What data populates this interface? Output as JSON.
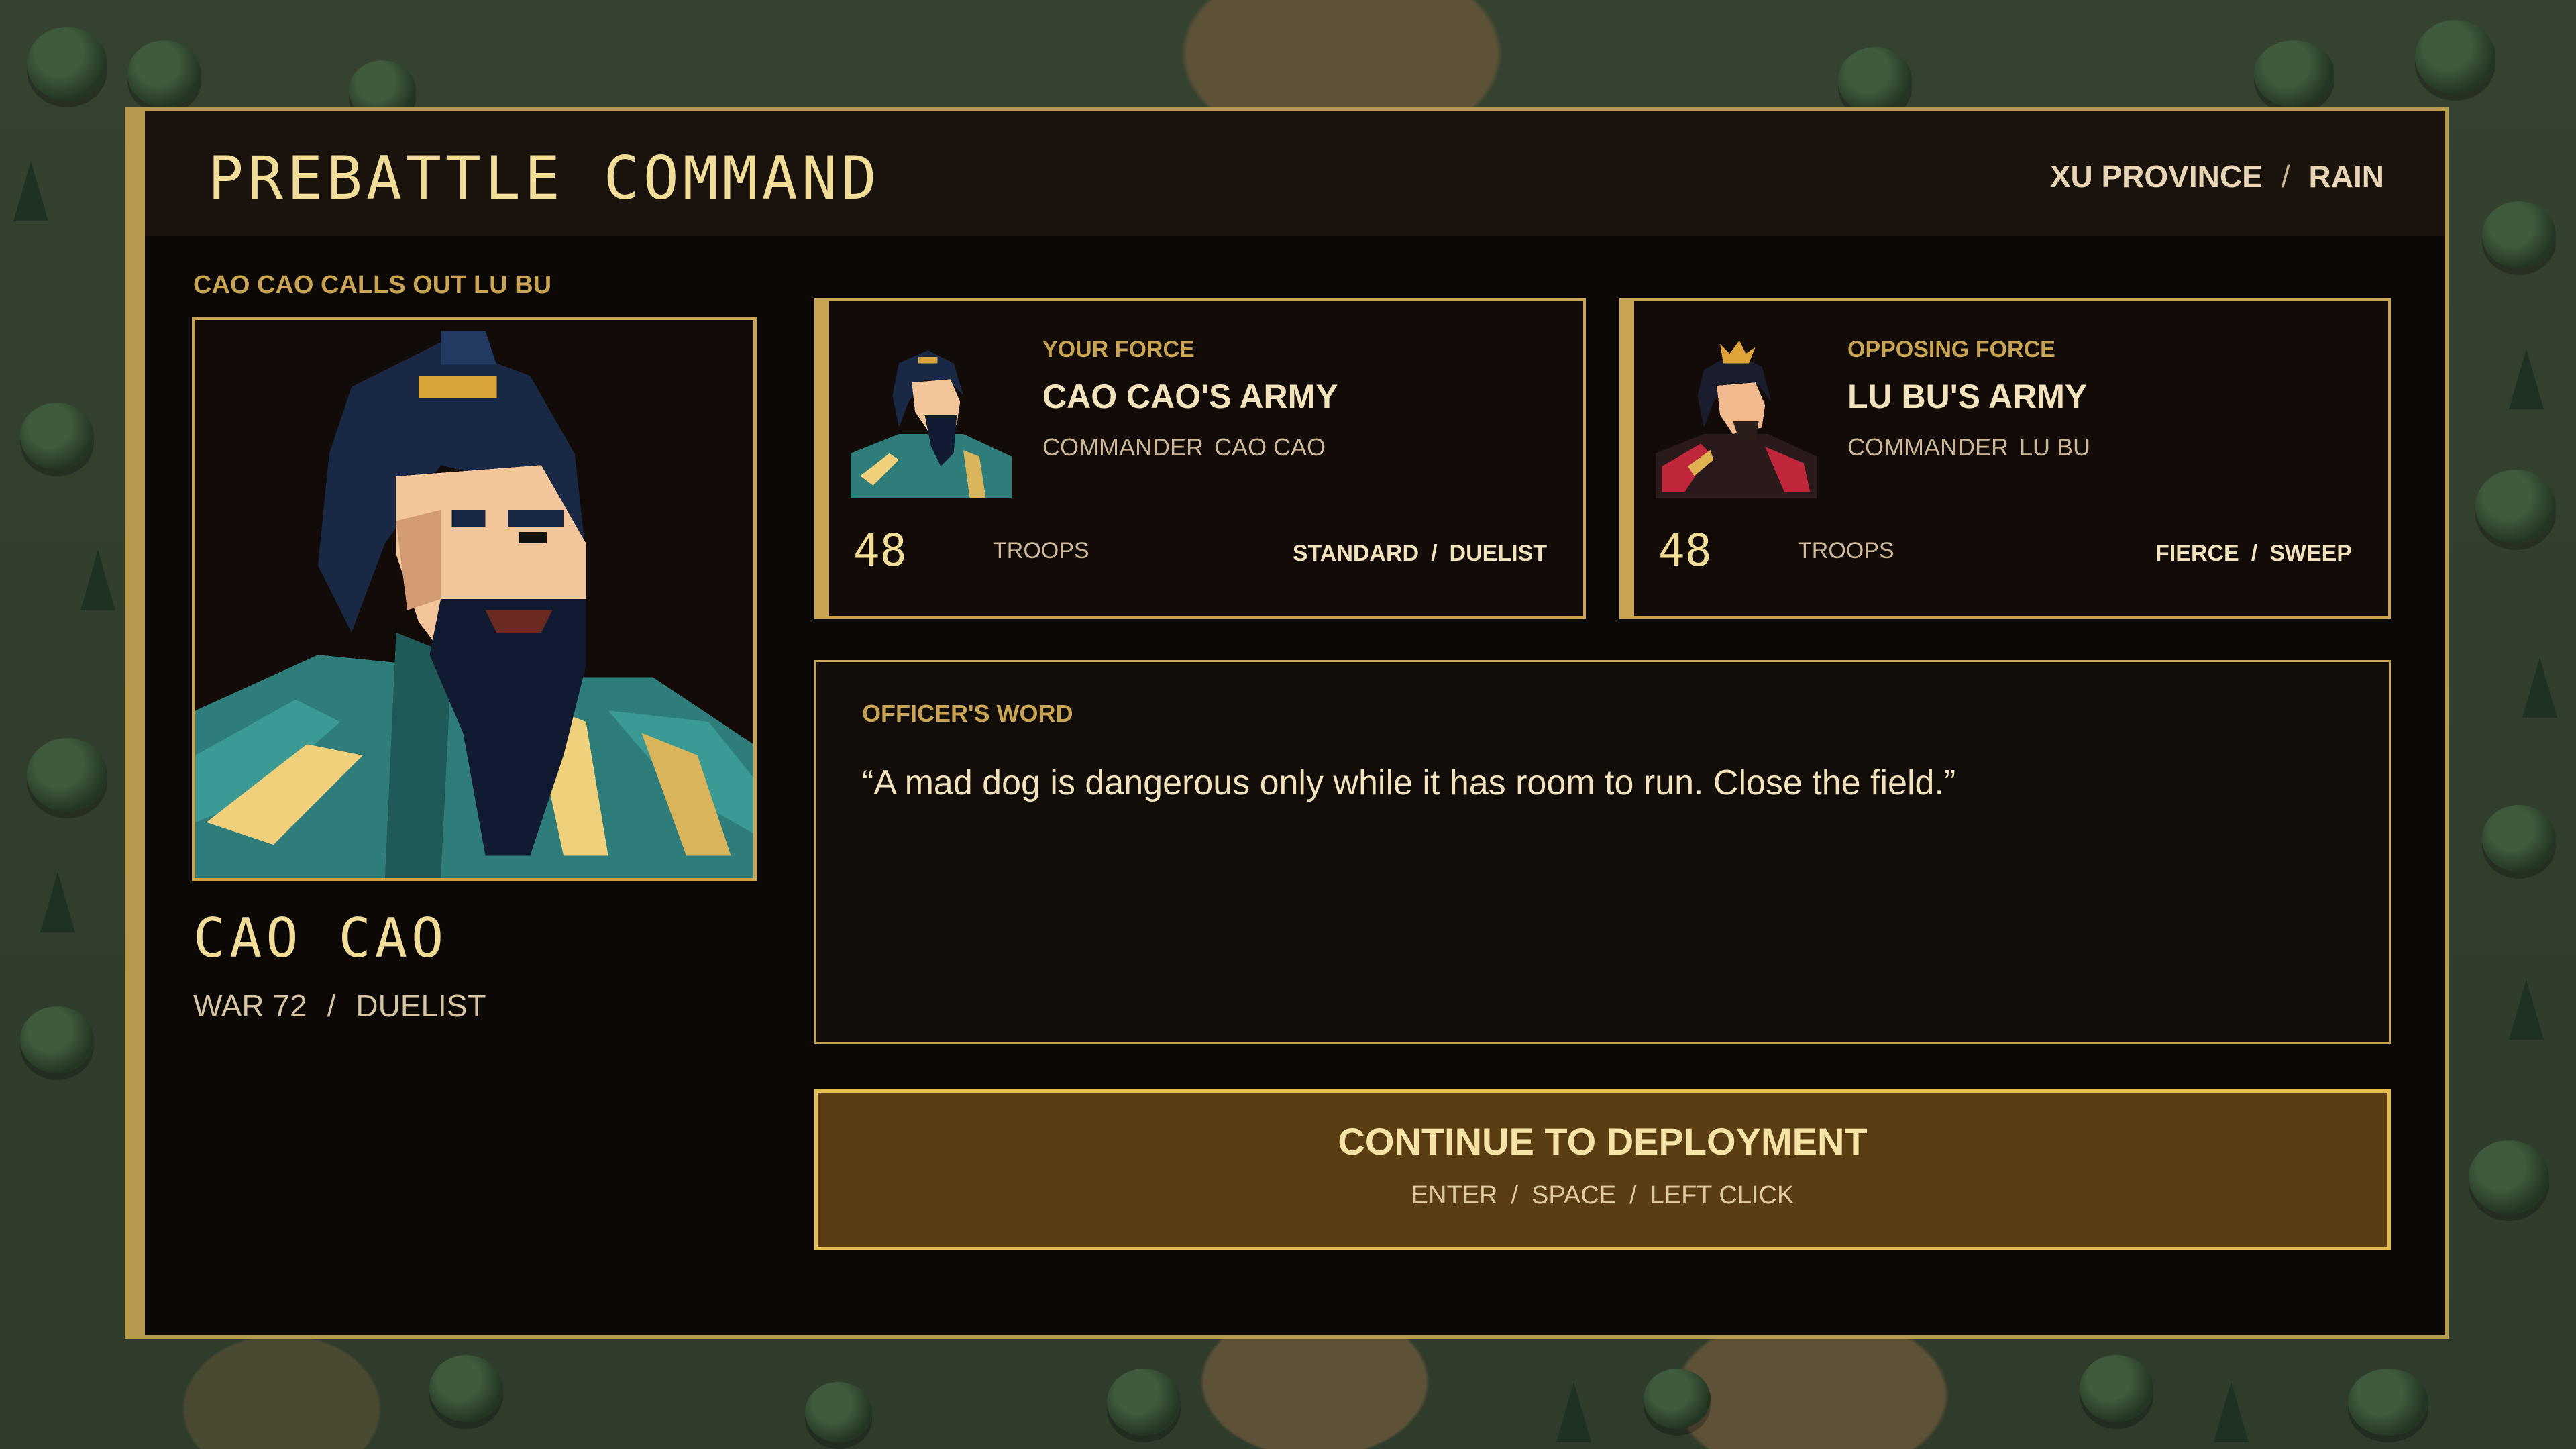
{
  "header": {
    "title": "PREBATTLE COMMAND",
    "location": "XU PROVINCE",
    "weather": "RAIN",
    "separator": "/"
  },
  "officer": {
    "callout": "CAO CAO CALLS OUT LU BU",
    "name": "CAO CAO",
    "stat": "WAR 72",
    "skill": "DUELIST",
    "portrait_icon": "cao-cao-portrait"
  },
  "your_force": {
    "kicker": "YOUR FORCE",
    "army": "CAO CAO'S ARMY",
    "commander_label": "COMMANDER",
    "commander": "CAO CAO",
    "troops": "48",
    "troops_label": "TROOPS",
    "formation": "STANDARD",
    "tactic": "DUELIST"
  },
  "opposing_force": {
    "kicker": "OPPOSING FORCE",
    "army": "LU BU'S ARMY",
    "commander_label": "COMMANDER",
    "commander": "LU BU",
    "troops": "48",
    "troops_label": "TROOPS",
    "formation": "FIERCE",
    "tactic": "SWEEP"
  },
  "officers_word": {
    "kicker": "OFFICER'S WORD",
    "quote": "“A mad dog is dangerous only while it has room to run. Close the field.”"
  },
  "continue": {
    "label": "CONTINUE TO DEPLOYMENT",
    "key1": "ENTER",
    "key2": "SPACE",
    "key3": "LEFT CLICK"
  },
  "colors": {
    "gold": "#c9a553",
    "panel": "#0b0806",
    "button": "#5b3d13",
    "button_border": "#e3bd4e"
  }
}
